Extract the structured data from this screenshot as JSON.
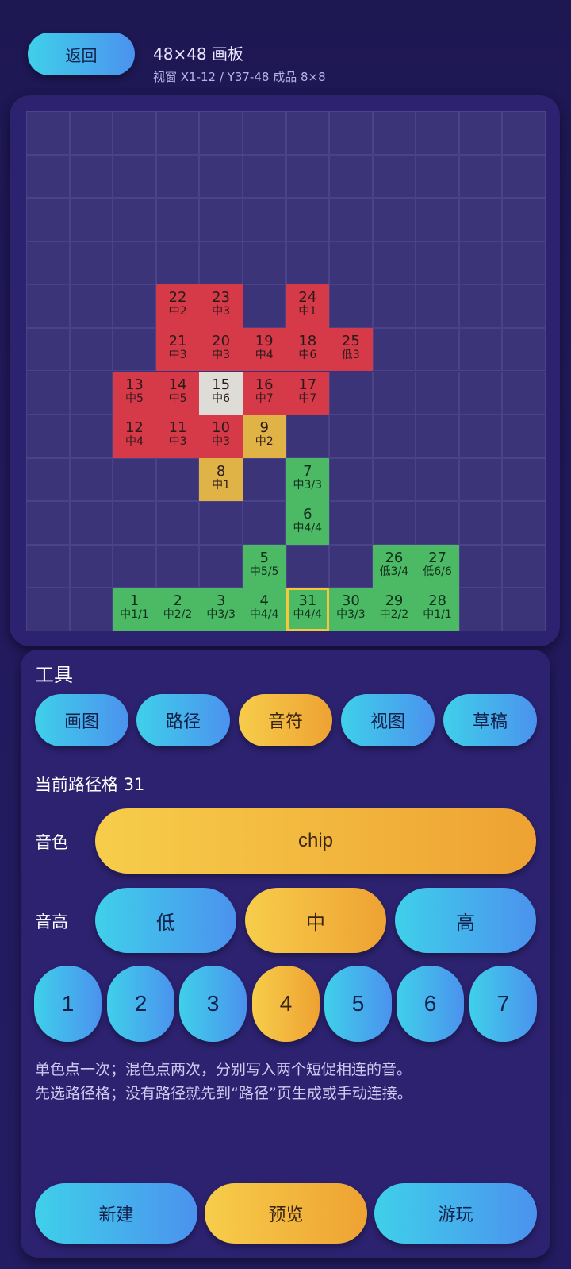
{
  "header": {
    "back_label": "返回",
    "title": "48×48 画板",
    "subtitle": "视窗 X1-12 / Y37-48  成品 8×8"
  },
  "board": {
    "cols": 12,
    "rows": 12,
    "notes": [
      {
        "label": "22",
        "sub": "中2",
        "col": 3,
        "row": 4,
        "color": "red"
      },
      {
        "label": "23",
        "sub": "中3",
        "col": 4,
        "row": 4,
        "color": "red"
      },
      {
        "label": "24",
        "sub": "中1",
        "col": 6,
        "row": 4,
        "color": "red"
      },
      {
        "label": "21",
        "sub": "中3",
        "col": 3,
        "row": 5,
        "color": "red"
      },
      {
        "label": "20",
        "sub": "中3",
        "col": 4,
        "row": 5,
        "color": "red"
      },
      {
        "label": "19",
        "sub": "中4",
        "col": 5,
        "row": 5,
        "color": "red"
      },
      {
        "label": "18",
        "sub": "中6",
        "col": 6,
        "row": 5,
        "color": "red"
      },
      {
        "label": "25",
        "sub": "低3",
        "col": 7,
        "row": 5,
        "color": "red"
      },
      {
        "label": "13",
        "sub": "中5",
        "col": 2,
        "row": 6,
        "color": "red"
      },
      {
        "label": "14",
        "sub": "中5",
        "col": 3,
        "row": 6,
        "color": "red"
      },
      {
        "label": "15",
        "sub": "中6",
        "col": 4,
        "row": 6,
        "color": "white"
      },
      {
        "label": "16",
        "sub": "中7",
        "col": 5,
        "row": 6,
        "color": "red"
      },
      {
        "label": "17",
        "sub": "中7",
        "col": 6,
        "row": 6,
        "color": "red"
      },
      {
        "label": "12",
        "sub": "中4",
        "col": 2,
        "row": 7,
        "color": "red"
      },
      {
        "label": "11",
        "sub": "中3",
        "col": 3,
        "row": 7,
        "color": "red"
      },
      {
        "label": "10",
        "sub": "中3",
        "col": 4,
        "row": 7,
        "color": "red"
      },
      {
        "label": "9",
        "sub": "中2",
        "col": 5,
        "row": 7,
        "color": "gold"
      },
      {
        "label": "8",
        "sub": "中1",
        "col": 4,
        "row": 8,
        "color": "gold"
      },
      {
        "label": "7",
        "sub": "中3/3",
        "col": 6,
        "row": 8,
        "color": "green"
      },
      {
        "label": "6",
        "sub": "中4/4",
        "col": 6,
        "row": 9,
        "color": "green"
      },
      {
        "label": "5",
        "sub": "中5/5",
        "col": 5,
        "row": 10,
        "color": "green"
      },
      {
        "label": "26",
        "sub": "低3/4",
        "col": 8,
        "row": 10,
        "color": "green"
      },
      {
        "label": "27",
        "sub": "低6/6",
        "col": 9,
        "row": 10,
        "color": "green"
      },
      {
        "label": "1",
        "sub": "中1/1",
        "col": 2,
        "row": 11,
        "color": "green"
      },
      {
        "label": "2",
        "sub": "中2/2",
        "col": 3,
        "row": 11,
        "color": "green"
      },
      {
        "label": "3",
        "sub": "中3/3",
        "col": 4,
        "row": 11,
        "color": "green"
      },
      {
        "label": "4",
        "sub": "中4/4",
        "col": 5,
        "row": 11,
        "color": "green"
      },
      {
        "label": "31",
        "sub": "中4/4",
        "col": 6,
        "row": 11,
        "color": "green",
        "selected": true
      },
      {
        "label": "30",
        "sub": "中3/3",
        "col": 7,
        "row": 11,
        "color": "green"
      },
      {
        "label": "29",
        "sub": "中2/2",
        "col": 8,
        "row": 11,
        "color": "green"
      },
      {
        "label": "28",
        "sub": "中1/1",
        "col": 9,
        "row": 11,
        "color": "green"
      }
    ]
  },
  "tools": {
    "title": "工具",
    "tabs": [
      "画图",
      "路径",
      "音符",
      "视图",
      "草稿"
    ],
    "active_tab": "音符",
    "current_cell": "当前路径格 31",
    "timbre_label": "音色",
    "timbre_value": "chip",
    "pitch_label": "音高",
    "pitches": [
      "低",
      "中",
      "高"
    ],
    "active_pitch": "中",
    "numbers": [
      "1",
      "2",
      "3",
      "4",
      "5",
      "6",
      "7"
    ],
    "active_number": "4",
    "help_line1": "单色点一次；混色点两次，分别写入两个短促相连的音。",
    "help_line2": "先选路径格；没有路径就先到“路径”页生成或手动连接。"
  },
  "footer": {
    "new_label": "新建",
    "preview_label": "预览",
    "play_label": "游玩"
  },
  "colors": {
    "accent_gold": "#f7cd4b",
    "accent_blue": "#3fd0ea",
    "panel": "#2c2270",
    "background": "#1d1752"
  }
}
